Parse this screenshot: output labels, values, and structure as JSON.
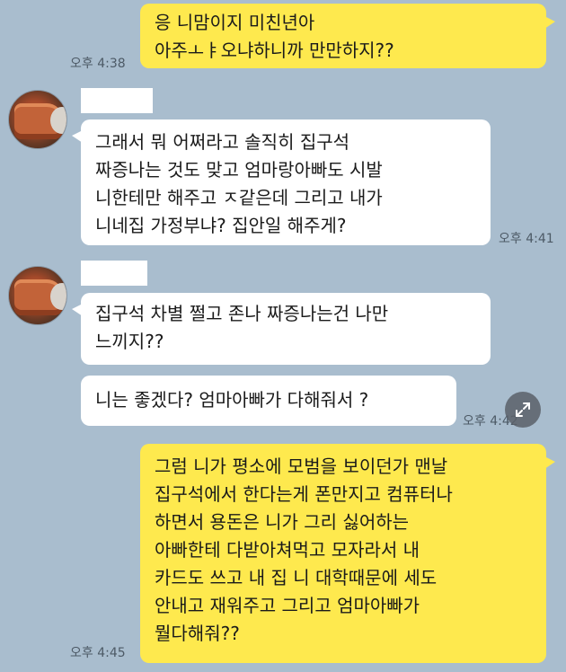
{
  "messages": [
    {
      "sender": "me",
      "text": "응 니맘이지 미친년아\n아주ㅗㅑ오냐하니까 만만하지??",
      "time": "오후 4:38"
    },
    {
      "sender": "other",
      "text": "그래서 뭐 어쩌라고 솔직히 집구석\n짜증나는 것도 맞고 엄마랑아빠도 시발\n니한테만 해주고 ㅈ같은데 그리고 내가\n니네집 가정부냐? 집안일 해주게?",
      "time": "오후 4:41"
    },
    {
      "sender": "other",
      "text": "집구석 차별 쩔고 존나 짜증나는건 나만\n느끼지??"
    },
    {
      "sender": "other",
      "text": "니는 좋겠다? 엄마아빠가 다해줘서 ?",
      "time": "오후 4:42"
    },
    {
      "sender": "me",
      "text": "그럼 니가 평소에 모범을 보이던가 맨날\n집구석에서 한다는게 폰만지고 컴퓨터나\n하면서 용돈은 니가 그리 싫어하는\n아빠한테 다받아쳐먹고 모자라서 내\n카드도 쓰고 내 집 니 대학때문에 세도\n안내고 재워주고 그리고 엄마아빠가\n뭘다해줘??",
      "time": "오후 4:45"
    }
  ],
  "icons": {
    "avatar": "profile-photo",
    "expand": "expand-arrows-icon"
  },
  "colors": {
    "background": "#a9bdce",
    "my_bubble": "#fee94e",
    "their_bubble": "#ffffff"
  }
}
